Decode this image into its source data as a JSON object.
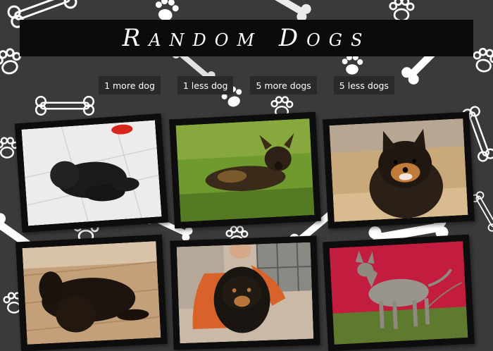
{
  "header": {
    "title": "Random Dogs"
  },
  "controls": {
    "more_one": "1 more dog",
    "less_one": "1 less dog",
    "more_five": "5 more dogs",
    "less_five": "5 less dogs"
  },
  "gallery": {
    "photos": [
      {
        "subject": "black miniature schnauzer puppy on tile floor"
      },
      {
        "subject": "african wild dog lying in grass"
      },
      {
        "subject": "black and tan spitz dog smiling"
      },
      {
        "subject": "black newfoundland dog lying on carpet"
      },
      {
        "subject": "tibetan mastiff puppy held by person"
      },
      {
        "subject": "hairless xoloitzcuintli dog on red background"
      }
    ]
  },
  "theme": {
    "background": "#3a3a3a",
    "title_bar": "#0b0b0b",
    "button_bg": "#2a2a2a",
    "frame": "#0d0d0d"
  }
}
